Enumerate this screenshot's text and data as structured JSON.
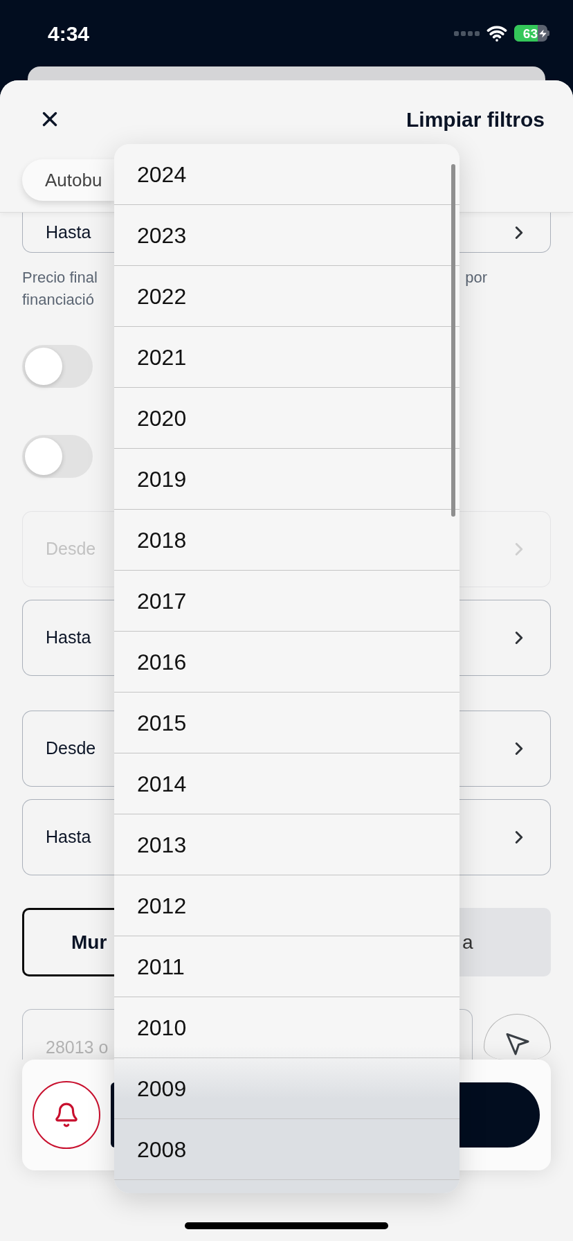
{
  "status_bar": {
    "time": "4:34",
    "battery": "63"
  },
  "header": {
    "clear_filters": "Limpiar filtros"
  },
  "chips": [
    {
      "label": "Autobu"
    }
  ],
  "price_field": {
    "label": "Hasta",
    "disabled": false
  },
  "price_note": {
    "lines": [
      "Precio final",
      "financiació"
    ],
    "tail": "por"
  },
  "toggles": [
    {
      "on": false
    },
    {
      "on": false
    }
  ],
  "range_groups": [
    [
      {
        "label": "Desde",
        "disabled": true
      },
      {
        "label": "Hasta",
        "disabled": false
      }
    ],
    [
      {
        "label": "Desde",
        "disabled": false
      },
      {
        "label": "Hasta",
        "disabled": false
      }
    ]
  ],
  "location_mode": [
    {
      "label": "Mur",
      "selected": true
    },
    {
      "label": "a",
      "selected": false
    }
  ],
  "postal_code": {
    "placeholder": "28013 o"
  },
  "year_dropdown": {
    "options": [
      "2024",
      "2023",
      "2022",
      "2021",
      "2020",
      "2019",
      "2018",
      "2017",
      "2016",
      "2015",
      "2014",
      "2013",
      "2012",
      "2011",
      "2010",
      "2009",
      "2008"
    ]
  }
}
